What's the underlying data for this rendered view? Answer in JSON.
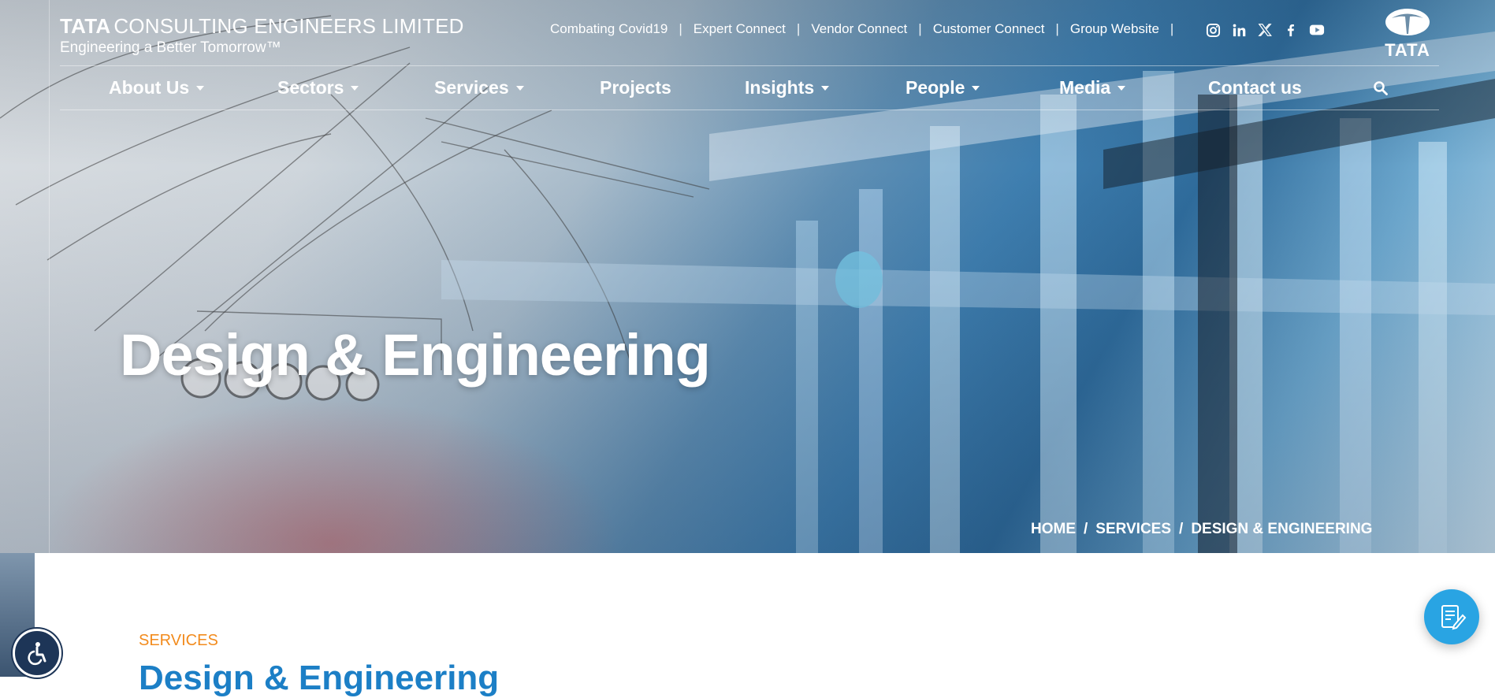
{
  "brand": {
    "name_bold": "TATA",
    "name_rest": "CONSULTING ENGINEERS LIMITED",
    "tagline": "Engineering a Better Tomorrow™",
    "logo_word": "TATA"
  },
  "top_links": [
    "Combating Covid19",
    "Expert Connect",
    "Vendor Connect",
    "Customer Connect",
    "Group Website"
  ],
  "top_link_separator": "|",
  "socials": [
    "instagram-icon",
    "linkedin-icon",
    "x-icon",
    "facebook-icon",
    "youtube-icon"
  ],
  "nav": {
    "items": [
      {
        "label": "About Us",
        "dropdown": true
      },
      {
        "label": "Sectors",
        "dropdown": true
      },
      {
        "label": "Services",
        "dropdown": true
      },
      {
        "label": "Projects",
        "dropdown": false
      },
      {
        "label": "Insights",
        "dropdown": true
      },
      {
        "label": "People",
        "dropdown": true
      },
      {
        "label": "Media",
        "dropdown": true
      },
      {
        "label": "Contact us",
        "dropdown": false
      }
    ],
    "search_icon": "search-icon"
  },
  "hero": {
    "title": "Design & Engineering",
    "breadcrumbs": [
      "HOME",
      "SERVICES",
      "DESIGN & ENGINEERING"
    ],
    "breadcrumb_separator": "/"
  },
  "section": {
    "eyebrow": "SERVICES",
    "title": "Design & Engineering"
  },
  "colors": {
    "accent_orange": "#f28b1d",
    "title_blue": "#1c7fc6",
    "fab_blue": "#29a4e3",
    "a11y_navy": "#1d3557"
  }
}
